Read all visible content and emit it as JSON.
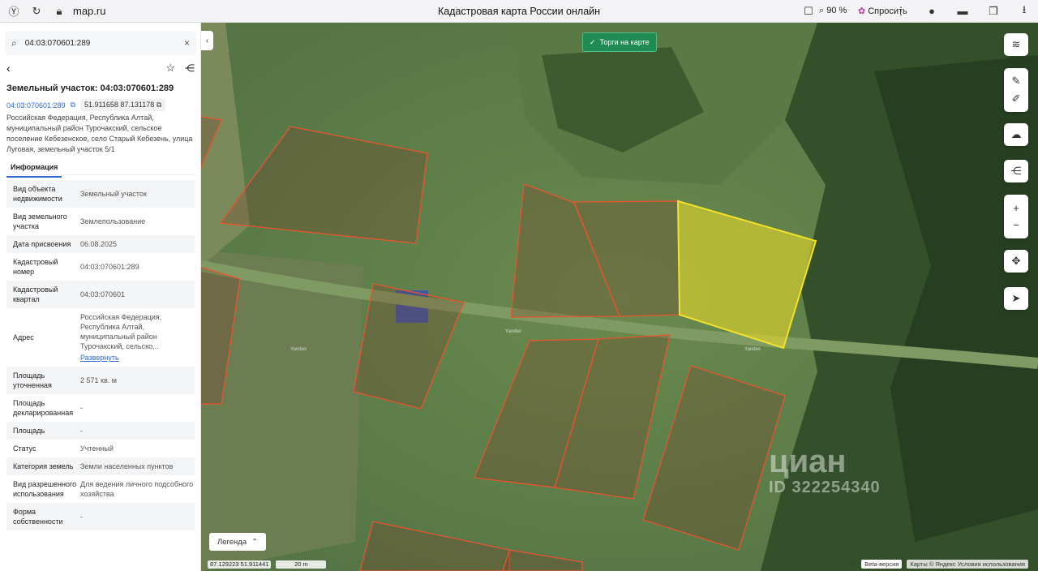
{
  "browser": {
    "url": "map.ru",
    "title": "Кадастровая карта России онлайн",
    "zoom": "90 %",
    "ask_label": "Спросить"
  },
  "sidebar": {
    "search_value": "04:03:070601:289",
    "parcel_title": "Земельный участок: 04:03:070601:289",
    "cad_link": "04:03:070601:289",
    "coords": "51.911658 87.131178",
    "address": "Российская Федерация, Республика Алтай, муниципальный район Турочакский, сельское поселение Кебезенское, село Старый Кебезень, улица Луговая, земельный участок 5/1",
    "tab_info": "Информация",
    "props": [
      {
        "k": "Вид объекта недвижимости",
        "v": "Земельный участок"
      },
      {
        "k": "Вид земельного участка",
        "v": "Землепользование"
      },
      {
        "k": "Дата присвоения",
        "v": "06.08.2025"
      },
      {
        "k": "Кадастровый номер",
        "v": "04:03:070601:289"
      },
      {
        "k": "Кадастровый квартал",
        "v": "04:03:070601"
      },
      {
        "k": "Адрес",
        "v": "Российская Федерация, Республика Алтай, муниципальный район Турочакский, сельско...",
        "link": "Развернуть"
      },
      {
        "k": "Площадь уточненная",
        "v": "2 571 кв. м"
      },
      {
        "k": "Площадь декларированная",
        "v": "-"
      },
      {
        "k": "Площадь",
        "v": "-"
      },
      {
        "k": "Статус",
        "v": "Учтенный"
      },
      {
        "k": "Категория земель",
        "v": "Земли населенных пунктов"
      },
      {
        "k": "Вид разрешенного использования",
        "v": "Для ведения личного подсобного хозяйства"
      },
      {
        "k": "Форма собственности",
        "v": "-"
      }
    ]
  },
  "map": {
    "torgi_label": "Торги на карте",
    "legend_label": "Легенда",
    "lon": "87.129223",
    "lat": "51.911441",
    "scale": "20 m",
    "beta": "Beta-версия",
    "copyright": "Карты © Яндекс   Условия использования",
    "road_label": "Yandex",
    "watermark_brand": "циан",
    "watermark_id": "ID 322254340"
  },
  "colors": {
    "parcel_stroke": "#e8552f",
    "selected_fill": "#e6d92a",
    "selected_stroke": "#f2e22a",
    "accent": "#2f6bd1",
    "torgi_bg": "#1f8a52"
  }
}
